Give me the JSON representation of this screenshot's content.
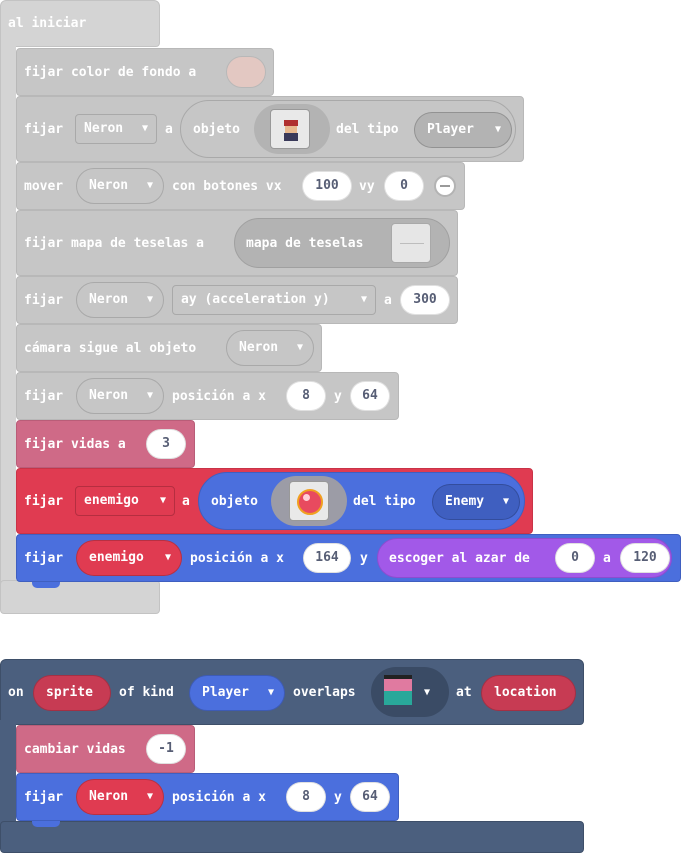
{
  "colors": {
    "event_disabled": "#d4d4d4",
    "block_disabled": "#c6c6c6",
    "oval_disabled": "#b3b3b3",
    "info_pink": "#cf6a87",
    "sprites_red": "#e03b51",
    "sprites_blue": "#4b6fdd",
    "math_purple": "#a259e8",
    "overlap_dark": "#4b5f7e",
    "event_dark": "#46597a"
  },
  "on_start": {
    "header": "al iniciar",
    "bg_block": {
      "text": "fijar color de fondo a",
      "swatch_color": "#e3c8c2"
    },
    "set_player": {
      "verb": "fijar",
      "var": "Neron",
      "a": "a",
      "obj": "objeto",
      "image_icon": "pirate-sprite-icon",
      "kind_label": "del tipo",
      "kind": "Player"
    },
    "move_block": {
      "verb": "mover",
      "var": "Neron",
      "label": "con botones vx",
      "vx": "100",
      "vy_label": "vy",
      "vy": "0"
    },
    "tilemap_block": {
      "text": "fijar mapa de teselas a",
      "inner": "mapa de teselas"
    },
    "accel_block": {
      "verb": "fijar",
      "var": "Neron",
      "prop": "ay (acceleration y)",
      "a": "a",
      "value": "300"
    },
    "camera_block": {
      "text": "cámara sigue al objeto",
      "var": "Neron"
    },
    "pos_block": {
      "verb": "fijar",
      "var": "Neron",
      "label": "posición a x",
      "x": "8",
      "y_label": "y",
      "y": "64"
    },
    "lives_block": {
      "text": "fijar vidas a",
      "value": "3"
    },
    "enemy_block": {
      "verb": "fijar",
      "var": "enemigo",
      "a": "a",
      "obj": "objeto",
      "image_icon": "orb-sprite-icon",
      "kind_label": "del tipo",
      "kind": "Enemy"
    },
    "enemy_pos": {
      "verb": "fijar",
      "var": "enemigo",
      "label": "posición a x",
      "x": "164",
      "y_label": "y",
      "random_label": "escoger al azar de",
      "from": "0",
      "a": "a",
      "to": "120"
    }
  },
  "overlap_event": {
    "on": "on",
    "sprite": "sprite",
    "of_kind": "of kind",
    "kind": "Player",
    "overlaps": "overlaps",
    "other_icon": "sprite-pair-icon",
    "at": "at",
    "location": "location",
    "change_lives": {
      "text": "cambiar vidas",
      "value": "-1"
    },
    "set_pos": {
      "verb": "fijar",
      "var": "Neron",
      "label": "posición a x",
      "x": "8",
      "y_label": "y",
      "y": "64"
    }
  }
}
